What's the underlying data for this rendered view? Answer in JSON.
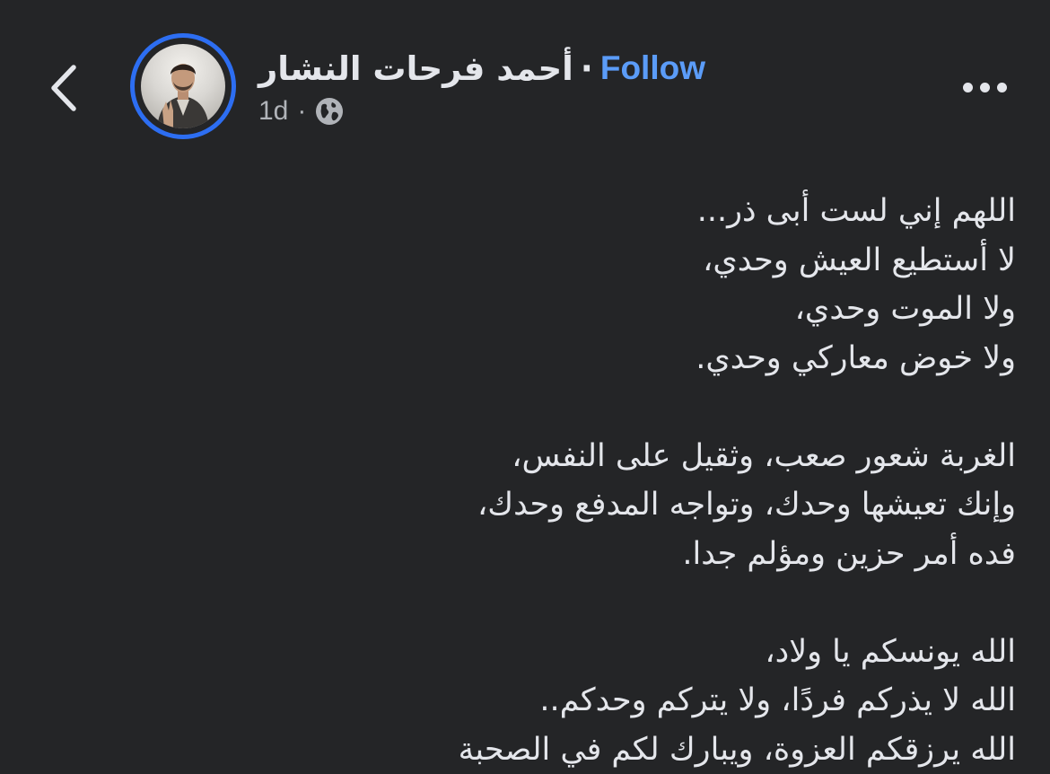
{
  "header": {
    "back_icon": "chevron-left-icon",
    "author_name": "أحمد فرحات النشار",
    "separator": "·",
    "follow_label": "Follow",
    "follow_color": "#5b9cf8",
    "time_ago": "1d",
    "meta_separator": "·",
    "privacy_icon": "globe-icon",
    "more_icon": "more-horizontal-icon",
    "avatar_ring_color": "#2d6ef2"
  },
  "post": {
    "paragraphs": [
      {
        "lines": [
          "اللهم إني لست أبى ذر...",
          "لا أستطيع العيش وحدي،",
          "ولا الموت وحدي،",
          " ولا خوض معاركي وحدي."
        ]
      },
      {
        "lines": [
          "الغربة شعور صعب، وثقيل على النفس،",
          "وإنك تعيشها وحدك، وتواجه المدفع وحدك،",
          "فده أمر حزين ومؤلم جدا."
        ]
      },
      {
        "lines": [
          "الله يونسكم يا ولاد،",
          "الله لا يذركم فردًا، ولا يتركم وحدكم..",
          "الله يرزقكم العزوة، ويبارك لكم في الصحبة"
        ]
      }
    ]
  },
  "colors": {
    "background": "#242527",
    "text_primary": "#e4e6eb",
    "text_secondary": "#b0b3b8"
  }
}
